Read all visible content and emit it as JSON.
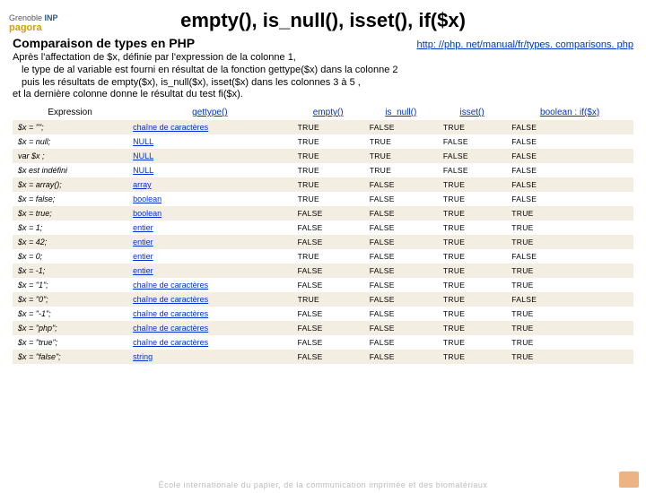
{
  "logo": {
    "line1": "Grenoble",
    "line2": "INP",
    "line3": "pagora"
  },
  "title": "empty(), is_null(), isset(), if($x)",
  "subtitle": "Comparaison de types en PHP",
  "link": "http: //php. net/manual/fr/types. comparisons. php",
  "intro": [
    "Après l'affectation de $x, définie par l'expression de la colonne 1,",
    "le type de al variable est fourni en résultat de la fonction gettype($x) dans la colonne 2",
    "puis les résultats de empty($x), is_null($x), isset($x) dans les colonnes 3 à 5 ,",
    "et la dernière colonne donne le résultat du test fi($x)."
  ],
  "headers": [
    "Expression",
    "gettype()",
    "empty()",
    "is_null()",
    "isset()",
    "boolean : if($x)"
  ],
  "rows": [
    {
      "e": "$x = \"\";",
      "t": "chaîne de caractères",
      "v": [
        "TRUE",
        "FALSE",
        "TRUE",
        "FALSE"
      ],
      "s": true
    },
    {
      "e": "$x = null;",
      "t": "NULL",
      "v": [
        "TRUE",
        "TRUE",
        "FALSE",
        "FALSE"
      ],
      "s": false
    },
    {
      "e": "var $x ;",
      "t": "NULL",
      "v": [
        "TRUE",
        "TRUE",
        "FALSE",
        "FALSE"
      ],
      "s": true
    },
    {
      "e": "$x est indéfini",
      "t": "NULL",
      "v": [
        "TRUE",
        "TRUE",
        "FALSE",
        "FALSE"
      ],
      "s": false
    },
    {
      "e": "$x = array();",
      "t": "array",
      "v": [
        "TRUE",
        "FALSE",
        "TRUE",
        "FALSE"
      ],
      "s": true
    },
    {
      "e": "$x = false;",
      "t": "boolean",
      "v": [
        "TRUE",
        "FALSE",
        "TRUE",
        "FALSE"
      ],
      "s": false
    },
    {
      "e": "$x = true;",
      "t": "boolean",
      "v": [
        "FALSE",
        "FALSE",
        "TRUE",
        "TRUE"
      ],
      "s": true
    },
    {
      "e": "$x = 1;",
      "t": "entier",
      "v": [
        "FALSE",
        "FALSE",
        "TRUE",
        "TRUE"
      ],
      "s": false
    },
    {
      "e": "$x = 42;",
      "t": "entier",
      "v": [
        "FALSE",
        "FALSE",
        "TRUE",
        "TRUE"
      ],
      "s": true
    },
    {
      "e": "$x = 0;",
      "t": "entier",
      "v": [
        "TRUE",
        "FALSE",
        "TRUE",
        "FALSE"
      ],
      "s": false
    },
    {
      "e": "$x = -1;",
      "t": "entier",
      "v": [
        "FALSE",
        "FALSE",
        "TRUE",
        "TRUE"
      ],
      "s": true
    },
    {
      "e": "$x = \"1\";",
      "t": "chaîne de caractères",
      "v": [
        "FALSE",
        "FALSE",
        "TRUE",
        "TRUE"
      ],
      "s": false
    },
    {
      "e": "$x = \"0\";",
      "t": "chaîne de caractères",
      "v": [
        "TRUE",
        "FALSE",
        "TRUE",
        "FALSE"
      ],
      "s": true
    },
    {
      "e": "$x = \"-1\";",
      "t": "chaîne de caractères",
      "v": [
        "FALSE",
        "FALSE",
        "TRUE",
        "TRUE"
      ],
      "s": false
    },
    {
      "e": "$x = \"php\";",
      "t": "chaîne de caractères",
      "v": [
        "FALSE",
        "FALSE",
        "TRUE",
        "TRUE"
      ],
      "s": true
    },
    {
      "e": "$x = \"true\";",
      "t": "chaîne de caractères",
      "v": [
        "FALSE",
        "FALSE",
        "TRUE",
        "TRUE"
      ],
      "s": false
    },
    {
      "e": "$x = \"false\";",
      "t": "string",
      "v": [
        "FALSE",
        "FALSE",
        "TRUE",
        "TRUE"
      ],
      "s": true
    }
  ],
  "footer": "École internationale du papier, de la communication imprimée et des biomatériaux"
}
